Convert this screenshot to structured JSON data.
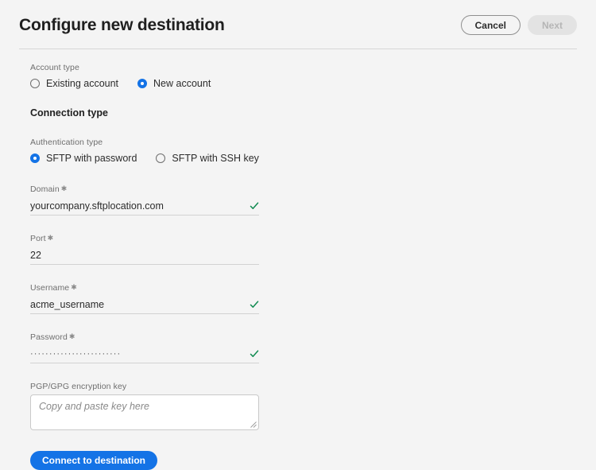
{
  "header": {
    "title": "Configure new destination",
    "cancel_label": "Cancel",
    "next_label": "Next"
  },
  "form": {
    "account_type": {
      "label": "Account type",
      "options": [
        {
          "label": "Existing account",
          "selected": false
        },
        {
          "label": "New account",
          "selected": true
        }
      ]
    },
    "connection_type_heading": "Connection type",
    "authentication_type": {
      "label": "Authentication type",
      "options": [
        {
          "label": "SFTP with password",
          "selected": true
        },
        {
          "label": "SFTP with SSH key",
          "selected": false
        }
      ]
    },
    "fields": [
      {
        "label": "Domain",
        "required_mark": "✱",
        "value": "yourcompany.sftplocation.com",
        "valid": true
      },
      {
        "label": "Port",
        "required_mark": "✱",
        "value": "22",
        "valid": false
      },
      {
        "label": "Username",
        "required_mark": "✱",
        "value": "acme_username",
        "valid": true
      },
      {
        "label": "Password",
        "required_mark": "✱",
        "value": "························",
        "valid": true
      }
    ],
    "pgp_key": {
      "label": "PGP/GPG encryption key",
      "placeholder": "Copy and paste key here",
      "value": ""
    },
    "submit_label": "Connect to destination"
  },
  "colors": {
    "accent_blue": "#1473e6",
    "valid_green": "#0f8a50",
    "background": "#f4f4f4",
    "label_gray": "#6e6e6e"
  }
}
